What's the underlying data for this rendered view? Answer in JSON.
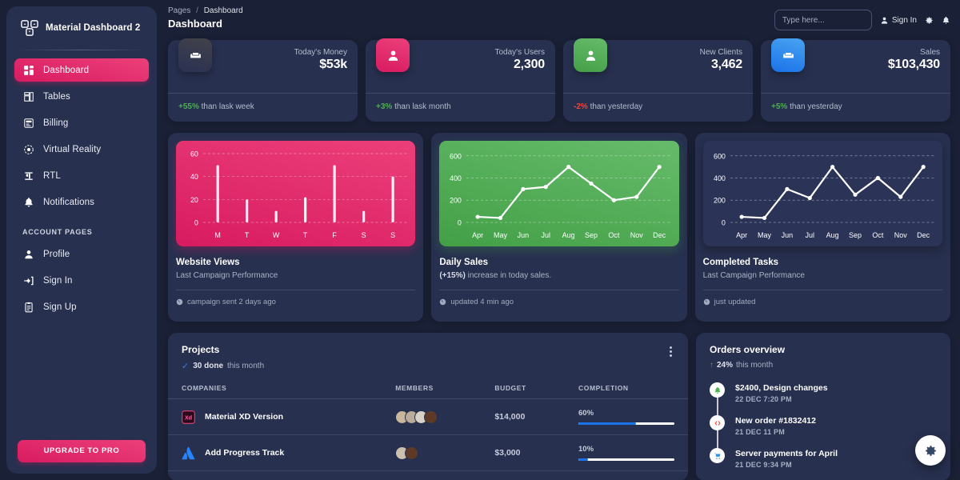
{
  "sidebar": {
    "brand": "Material Dashboard 2",
    "brand_logo_icon": "material-logo-icon",
    "items": [
      {
        "label": "Dashboard",
        "icon": "dashboard-icon",
        "active": true
      },
      {
        "label": "Tables",
        "icon": "tables-icon",
        "active": false
      },
      {
        "label": "Billing",
        "icon": "billing-icon",
        "active": false
      },
      {
        "label": "Virtual Reality",
        "icon": "vr-icon",
        "active": false
      },
      {
        "label": "RTL",
        "icon": "rtl-icon",
        "active": false
      },
      {
        "label": "Notifications",
        "icon": "bell-icon",
        "active": false
      }
    ],
    "section_label": "ACCOUNT PAGES",
    "account_items": [
      {
        "label": "Profile",
        "icon": "person-icon"
      },
      {
        "label": "Sign In",
        "icon": "login-icon"
      },
      {
        "label": "Sign Up",
        "icon": "signup-icon"
      }
    ],
    "upgrade_label": "UPGRADE TO PRO"
  },
  "header": {
    "breadcrumb_root": "Pages",
    "breadcrumb_sep": "/",
    "breadcrumb_current": "Dashboard",
    "page_title": "Dashboard",
    "search_placeholder": "Type here...",
    "search_value": "",
    "sign_in_label": "Sign In",
    "settings_icon": "gear-icon",
    "notifications_icon": "bell-icon"
  },
  "stats": [
    {
      "label": "Today's Money",
      "value": "$53k",
      "delta": "+55%",
      "delta_dir": "up",
      "delta_text": "than lask week",
      "icon": "weekend-icon",
      "color": "#323a5e"
    },
    {
      "label": "Today's Users",
      "value": "2,300",
      "delta": "+3%",
      "delta_dir": "up",
      "delta_text": "than lask month",
      "icon": "person-icon",
      "color": "#e91e63"
    },
    {
      "label": "New Clients",
      "value": "3,462",
      "delta": "-2%",
      "delta_dir": "down",
      "delta_text": "than yesterday",
      "icon": "person-add-icon",
      "color": "#4caf50"
    },
    {
      "label": "Sales",
      "value": "$103,430",
      "delta": "+5%",
      "delta_dir": "up",
      "delta_text": "than yesterday",
      "icon": "store-icon",
      "color": "#2196f3"
    }
  ],
  "chart_data": [
    {
      "type": "bar",
      "title": "Website Views",
      "subtitle": "Last Campaign Performance",
      "footer": "campaign sent 2 days ago",
      "footer_icon": "clock-icon",
      "theme": "pink",
      "categories": [
        "M",
        "T",
        "W",
        "T",
        "F",
        "S",
        "S"
      ],
      "values": [
        50,
        20,
        10,
        22,
        50,
        10,
        40
      ],
      "yticks": [
        0,
        20,
        40,
        60
      ],
      "ylim": [
        0,
        60
      ],
      "xlabel": "",
      "ylabel": "",
      "grid": true,
      "legend": "none"
    },
    {
      "type": "line",
      "title": "Daily Sales",
      "subtitle_bold": "(+15%)",
      "subtitle": " increase in today sales.",
      "footer": "updated 4 min ago",
      "footer_icon": "clock-icon",
      "theme": "green",
      "categories": [
        "Apr",
        "May",
        "Jun",
        "Jul",
        "Aug",
        "Sep",
        "Oct",
        "Nov",
        "Dec"
      ],
      "values": [
        50,
        40,
        300,
        320,
        500,
        350,
        200,
        230,
        500
      ],
      "yticks": [
        0,
        200,
        400,
        600
      ],
      "ylim": [
        0,
        620
      ],
      "xlabel": "",
      "ylabel": "",
      "grid": true,
      "legend": "none"
    },
    {
      "type": "line",
      "title": "Completed Tasks",
      "subtitle": "Last Campaign Performance",
      "footer": "just updated",
      "footer_icon": "clock-icon",
      "theme": "dark",
      "categories": [
        "Apr",
        "May",
        "Jun",
        "Jul",
        "Aug",
        "Sep",
        "Oct",
        "Nov",
        "Dec"
      ],
      "values": [
        50,
        40,
        300,
        220,
        500,
        250,
        400,
        230,
        500
      ],
      "yticks": [
        0,
        200,
        400,
        600
      ],
      "ylim": [
        0,
        620
      ],
      "xlabel": "",
      "ylabel": "",
      "grid": true,
      "legend": "none"
    }
  ],
  "projects": {
    "title": "Projects",
    "done_count": "30 done",
    "done_suffix": "this month",
    "menu_icon": "more-vertical-icon",
    "columns": [
      "COMPANIES",
      "MEMBERS",
      "BUDGET",
      "COMPLETION"
    ],
    "rows": [
      {
        "name": "Material XD Version",
        "logo": "xd-icon",
        "members": [
          "#c9b79c",
          "#b9ad9a",
          "#d8d2c6",
          "#5e3a26"
        ],
        "budget": "$14,000",
        "completion": "60%",
        "completion_value": 60
      },
      {
        "name": "Add Progress Track",
        "logo": "atlassian-icon",
        "members": [
          "#cbbfae",
          "#5e3a26"
        ],
        "budget": "$3,000",
        "completion": "10%",
        "completion_value": 10
      }
    ]
  },
  "orders": {
    "title": "Orders overview",
    "delta": "24%",
    "delta_suffix": "this month",
    "delta_icon": "arrow-up-icon",
    "items": [
      {
        "title": "$2400, Design changes",
        "date": "22 DEC 7:20 PM",
        "icon": "bell-icon",
        "color": "#4caf50"
      },
      {
        "title": "New order #1832412",
        "date": "21 DEC 11 PM",
        "icon": "code-icon",
        "color": "#f44335"
      },
      {
        "title": "Server payments for April",
        "date": "21 DEC 9:34 PM",
        "icon": "cart-icon",
        "color": "#2196f3"
      }
    ]
  },
  "fab": {
    "icon": "gear-icon"
  },
  "theme": {
    "background": "#1a2035",
    "card": "#27304f",
    "sidebar": "#27304f",
    "accent_pink": "#d81b60",
    "accent_green": "#43a047",
    "accent_blue": "#2196f3",
    "progress_blue": "#1A73E8",
    "success": "#4caf50",
    "danger": "#f44335",
    "text_primary": "#ffffff",
    "text_secondary": "#a8b0c4"
  }
}
